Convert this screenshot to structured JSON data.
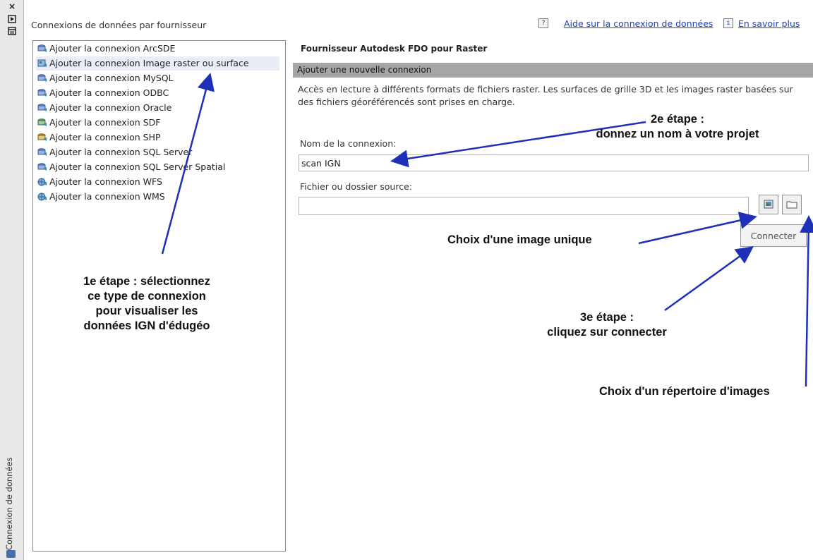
{
  "palette": {
    "close_glyph": "×",
    "vertical_title": "Connexion de données"
  },
  "header": {
    "title": "Connexions de données par fournisseur",
    "help_icon_glyph": "?",
    "help_link": "Aide sur la connexion de données",
    "info_icon_glyph": "i",
    "info_link": "En savoir plus"
  },
  "providers": [
    {
      "label": "Ajouter la connexion ArcSDE",
      "icon": "database-icon"
    },
    {
      "label": "Ajouter la connexion Image raster ou surface",
      "icon": "raster-database-icon"
    },
    {
      "label": "Ajouter la connexion MySQL",
      "icon": "database-icon"
    },
    {
      "label": "Ajouter la connexion ODBC",
      "icon": "database-icon"
    },
    {
      "label": "Ajouter la connexion Oracle",
      "icon": "database-icon"
    },
    {
      "label": "Ajouter la connexion SDF",
      "icon": "sdf-database-icon"
    },
    {
      "label": "Ajouter la connexion SHP",
      "icon": "shp-database-icon"
    },
    {
      "label": "Ajouter la connexion SQL Server",
      "icon": "database-icon"
    },
    {
      "label": "Ajouter la connexion SQL Server Spatial",
      "icon": "database-icon"
    },
    {
      "label": "Ajouter la connexion WFS",
      "icon": "web-service-icon"
    },
    {
      "label": "Ajouter la connexion WMS",
      "icon": "web-service-icon"
    }
  ],
  "detail": {
    "provider_name": "Fournisseur Autodesk FDO pour Raster",
    "section_title": "Ajouter une nouvelle connexion",
    "description": "Accès en lecture à différents formats de fichiers raster. Les surfaces de grille 3D et les images raster basées sur des fichiers géoréférencés sont prises en charge.",
    "name_label": "Nom de la connexion:",
    "name_value": "scan IGN",
    "source_label": "Fichier ou dossier source:",
    "source_value": "",
    "connect_label": "Connecter"
  },
  "annotations": {
    "step1_line1": "1e étape : sélectionnez",
    "step1_line2": "ce type de connexion",
    "step1_line3": "pour visualiser les",
    "step1_line4": "données IGN d'édugéo",
    "step2_line1": "2e étape :",
    "step2_line2": "donnez un nom à votre projet",
    "single_image": "Choix d'une image unique",
    "step3_line1": "3e étape :",
    "step3_line2": "cliquez sur connecter",
    "image_folder": "Choix d'un répertoire d'images"
  },
  "colors": {
    "link": "#1a3ec9",
    "section_bar": "#a6a6a6",
    "arrow": "#1e2fb8"
  }
}
